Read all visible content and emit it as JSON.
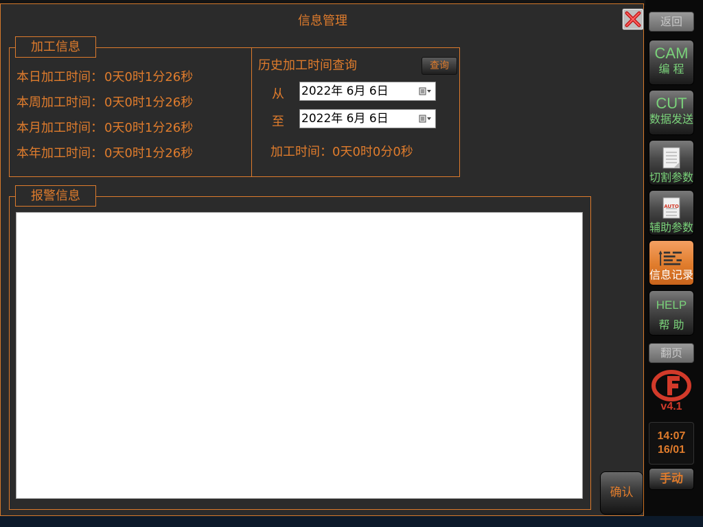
{
  "dialog": {
    "title": "信息管理",
    "close_label": "X"
  },
  "processing_info": {
    "group_label": "加工信息",
    "rows": [
      {
        "label": "本日加工时间：",
        "value": "0天0时1分26秒"
      },
      {
        "label": "本周加工时间：",
        "value": "0天0时1分26秒"
      },
      {
        "label": "本月加工时间：",
        "value": "0天0时1分26秒"
      },
      {
        "label": "本年加工时间：",
        "value": "0天0时1分26秒"
      }
    ]
  },
  "history": {
    "title": "历史加工时间查询",
    "query_button": "查询",
    "from_label": "从",
    "to_label": "至",
    "from_date": "2022年  6月  6日",
    "to_date": "2022年  6月  6日",
    "result": "加工时间：0天0时0分0秒"
  },
  "alarm": {
    "group_label": "报警信息"
  },
  "confirm_button": "确认",
  "sidebar": {
    "back": "返回",
    "cam_big": "CAM",
    "cam_sub": "编 程",
    "cut_big": "CUT",
    "cut_sub": "数据发送",
    "cut_params": "切割参数",
    "aux_params": "辅助参数",
    "aux_icon_text": "AUTO",
    "info_log": "信息记录",
    "help_big": "HELP",
    "help_sub": "帮 助",
    "page_turn": "翻页",
    "version": "v4.1",
    "time": "14:07",
    "date": "16/01",
    "mode": "手动"
  },
  "colors": {
    "accent": "#e07c2c",
    "panel": "#2b2b2b",
    "green_label": "#7ad27a",
    "version_red": "#d23a2a"
  }
}
